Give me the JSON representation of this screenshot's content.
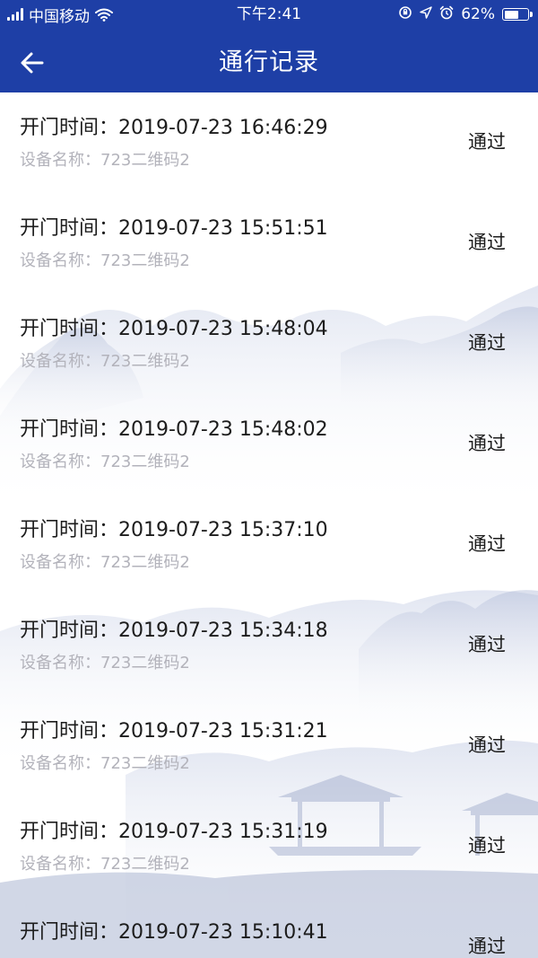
{
  "status_bar": {
    "carrier": "中国移动",
    "time": "下午2:41",
    "battery_percent": "62%",
    "battery_level": 0.62
  },
  "header": {
    "title": "通行记录"
  },
  "labels": {
    "open_time": "开门时间：",
    "device_name": "设备名称："
  },
  "records": [
    {
      "time": "2019-07-23 16:46:29",
      "device": "723二维码2",
      "status": "通过"
    },
    {
      "time": "2019-07-23 15:51:51",
      "device": "723二维码2",
      "status": "通过"
    },
    {
      "time": "2019-07-23 15:48:04",
      "device": "723二维码2",
      "status": "通过"
    },
    {
      "time": "2019-07-23 15:48:02",
      "device": "723二维码2",
      "status": "通过"
    },
    {
      "time": "2019-07-23 15:37:10",
      "device": "723二维码2",
      "status": "通过"
    },
    {
      "time": "2019-07-23 15:34:18",
      "device": "723二维码2",
      "status": "通过"
    },
    {
      "time": "2019-07-23 15:31:21",
      "device": "723二维码2",
      "status": "通过"
    },
    {
      "time": "2019-07-23 15:31:19",
      "device": "723二维码2",
      "status": "通过"
    },
    {
      "time": "2019-07-23 15:10:41",
      "device": "",
      "status": "通过"
    }
  ],
  "colors": {
    "header_bg": "#1e3fa6",
    "primary_text": "#1c1c1c",
    "secondary_text": "#b3b3bb",
    "landscape_tint": "#c9d1e6"
  },
  "icons": {
    "signal": "signal-icon",
    "wifi": "wifi-icon",
    "lock_rotation": "orientation-lock-icon",
    "location": "location-arrow-icon",
    "alarm": "alarm-icon",
    "battery": "battery-icon",
    "back": "back-arrow-icon"
  }
}
